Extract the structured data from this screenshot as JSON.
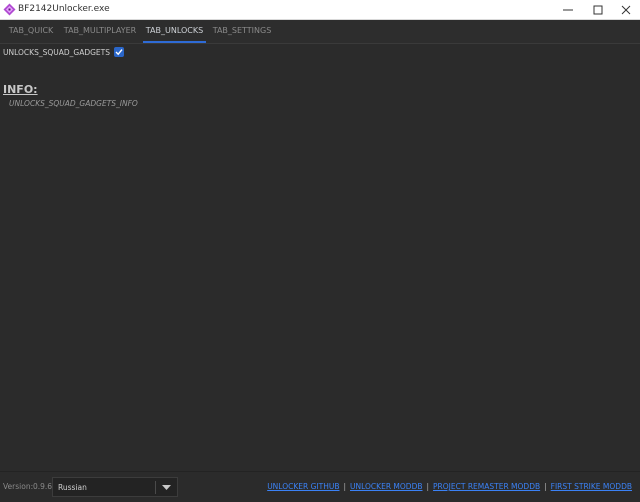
{
  "window": {
    "title": "BF2142Unlocker.exe",
    "icon": "app-icon",
    "controls": [
      "minimize-icon",
      "maximize-icon",
      "close-icon"
    ]
  },
  "tabs": [
    {
      "label": "TAB_QUICK",
      "active": false
    },
    {
      "label": "TAB_MULTIPLAYER",
      "active": false
    },
    {
      "label": "TAB_UNLOCKS",
      "active": true
    },
    {
      "label": "TAB_SETTINGS",
      "active": false
    }
  ],
  "unlocks": {
    "squad_gadgets_label": "UNLOCKS_SQUAD_GADGETS",
    "squad_gadgets_checked": true
  },
  "info": {
    "heading": "INFO:",
    "text": "UNLOCKS_SQUAD_GADGETS_INFO"
  },
  "footer": {
    "version_label": "Version:",
    "version_value": "0.9.6",
    "language": "Russian",
    "links": [
      "UNLOCKER GITHUB",
      "UNLOCKER MODDB",
      "PROJECT REMASTER MODDB",
      "FIRST STRIKE MODDB"
    ],
    "separator": "|"
  },
  "colors": {
    "accent": "#2e6bd6",
    "background": "#2b2b2b",
    "link": "#3b82f6"
  }
}
